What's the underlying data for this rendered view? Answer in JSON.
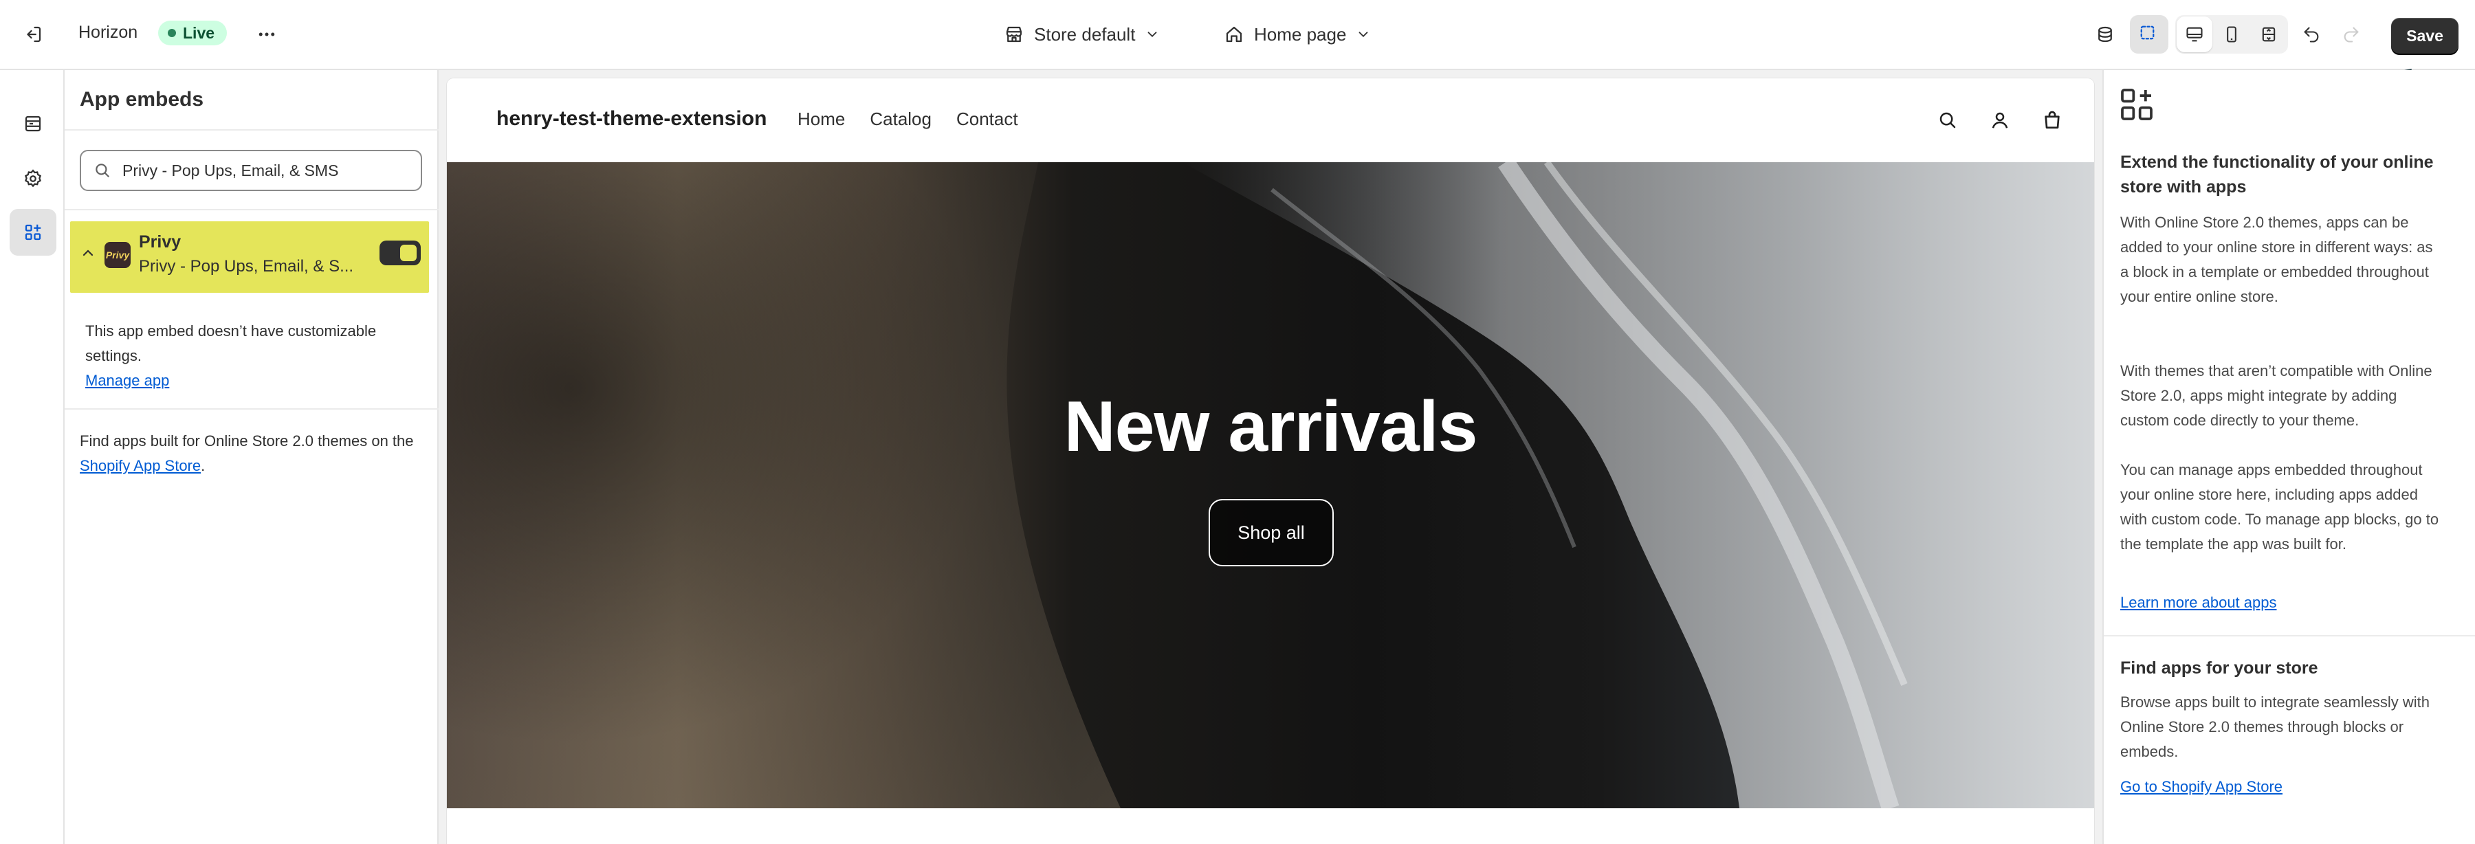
{
  "topbar": {
    "theme_name": "Horizon",
    "status_badge": "Live",
    "store_select": "Store default",
    "page_select": "Home page",
    "save_label": "Save",
    "icons": [
      "exit-icon",
      "more-icon",
      "store-icon",
      "inspector-icon",
      "desktop-icon",
      "mobile-icon",
      "fullscreen-icon",
      "undo-icon",
      "redo-icon"
    ]
  },
  "sidebar": {
    "items": [
      {
        "icon": "sections-icon"
      },
      {
        "icon": "settings-gear-icon"
      },
      {
        "icon": "app-embeds-icon",
        "active": true
      }
    ]
  },
  "app_embeds": {
    "title": "App embeds",
    "search_value": "Privy - Pop Ups, Email, & SMS",
    "app": {
      "name": "Privy",
      "subtitle": "Privy - Pop Ups, Email, & S...",
      "logo_text": "Privy",
      "enabled": true,
      "highlight_color": "#e4e55a"
    },
    "note": "This app embed doesn’t have customizable settings.",
    "manage_link": "Manage app",
    "find_text_before": "Find apps built for Online Store 2.0 themes on the ",
    "find_link": "Shopify App Store",
    "find_text_after": "."
  },
  "preview": {
    "store_name": "henry-test-theme-extension",
    "nav": [
      "Home",
      "Catalog",
      "Contact"
    ],
    "header_icons": [
      "search-icon",
      "account-icon",
      "cart-icon"
    ],
    "hero_title": "New arrivals",
    "hero_button": "Shop all"
  },
  "info_panel": {
    "heading": "Extend the functionality of your online store with apps",
    "paragraphs": [
      "With Online Store 2.0 themes, apps can be added to your online store in different ways: as a block in a template or embedded throughout your entire online store.",
      "With themes that aren’t compatible with Online Store 2.0, apps might integrate by adding custom code directly to your theme.",
      "You can manage apps embedded throughout your online store here, including apps added with custom code. To manage app blocks, go to the template the app was built for."
    ],
    "learn_link": "Learn more about apps",
    "find_heading": "Find apps for your store",
    "find_text": "Browse apps built to integrate seamlessly with Online Store 2.0 themes through blocks or embeds.",
    "store_link": "Go to Shopify App Store"
  },
  "colors": {
    "accent": "#005bd3",
    "save_bg": "#303030",
    "live_bg": "#cdfee1",
    "annotation_arrow": "#2f4a52"
  }
}
